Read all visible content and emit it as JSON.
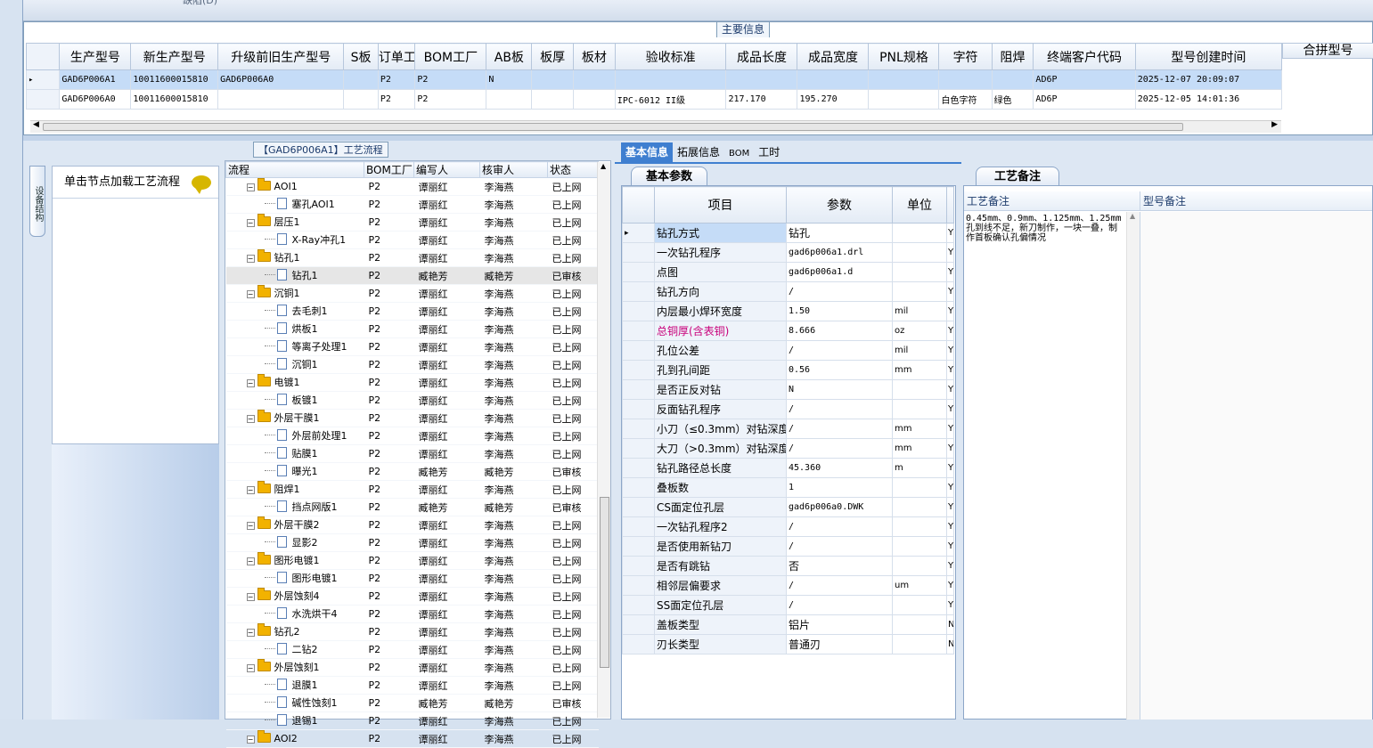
{
  "top": {
    "partial_text": "缺陷(D)"
  },
  "main": {
    "title": "主要信息",
    "columns": [
      "生产型号",
      "新生产型号",
      "升级前旧生产型号",
      "S板",
      "订单工厂",
      "BOM工厂",
      "AB板",
      "板厚",
      "板材",
      "验收标准",
      "成品长度",
      "成品宽度",
      "PNL规格",
      "字符",
      "阻焊",
      "终端客户代码",
      "型号创建时间"
    ],
    "rows": [
      [
        "GAD6P006A1",
        "10011600015810",
        "GAD6P006A0",
        "",
        "P2",
        "P2",
        "N",
        "",
        "",
        "",
        "",
        "",
        "",
        "",
        "",
        "AD6P",
        "2025-12-07 20:09:07"
      ],
      [
        "GAD6P006A0",
        "10011600015810",
        "",
        "",
        "P2",
        "P2",
        "",
        "",
        "",
        "IPC-6012 II级",
        "217.170",
        "195.270",
        "",
        "白色字符",
        "绿色",
        "AD6P",
        "2025-12-05 14:01:36"
      ]
    ],
    "merge_column": "合拼型号"
  },
  "side": {
    "vertical_tab": "设备结构",
    "hint": "单击节点加载工艺流程"
  },
  "tree": {
    "title": "【GAD6P006A1】工艺流程",
    "columns": [
      "流程",
      "BOM工厂",
      "编写人",
      "核审人",
      "状态"
    ],
    "rows": [
      {
        "name": "AOI1",
        "level": 0,
        "factory": "P2",
        "writer": "谭丽红",
        "reviewer": "李海燕",
        "status": "已上网"
      },
      {
        "name": "塞孔AOI1",
        "level": 1,
        "factory": "P2",
        "writer": "谭丽红",
        "reviewer": "李海燕",
        "status": "已上网"
      },
      {
        "name": "层压1",
        "level": 0,
        "factory": "P2",
        "writer": "谭丽红",
        "reviewer": "李海燕",
        "status": "已上网"
      },
      {
        "name": "X-Ray冲孔1",
        "level": 1,
        "factory": "P2",
        "writer": "谭丽红",
        "reviewer": "李海燕",
        "status": "已上网"
      },
      {
        "name": "钻孔1",
        "level": 0,
        "factory": "P2",
        "writer": "谭丽红",
        "reviewer": "李海燕",
        "status": "已上网"
      },
      {
        "name": "钻孔1",
        "level": 1,
        "factory": "P2",
        "writer": "臧艳芳",
        "reviewer": "臧艳芳",
        "status": "已审核",
        "highlight": true
      },
      {
        "name": "沉铜1",
        "level": 0,
        "factory": "P2",
        "writer": "谭丽红",
        "reviewer": "李海燕",
        "status": "已上网"
      },
      {
        "name": "去毛刺1",
        "level": 1,
        "factory": "P2",
        "writer": "谭丽红",
        "reviewer": "李海燕",
        "status": "已上网"
      },
      {
        "name": "烘板1",
        "level": 1,
        "factory": "P2",
        "writer": "谭丽红",
        "reviewer": "李海燕",
        "status": "已上网"
      },
      {
        "name": "等离子处理1",
        "level": 1,
        "factory": "P2",
        "writer": "谭丽红",
        "reviewer": "李海燕",
        "status": "已上网"
      },
      {
        "name": "沉铜1",
        "level": 1,
        "factory": "P2",
        "writer": "谭丽红",
        "reviewer": "李海燕",
        "status": "已上网"
      },
      {
        "name": "电镀1",
        "level": 0,
        "factory": "P2",
        "writer": "谭丽红",
        "reviewer": "李海燕",
        "status": "已上网"
      },
      {
        "name": "板镀1",
        "level": 1,
        "factory": "P2",
        "writer": "谭丽红",
        "reviewer": "李海燕",
        "status": "已上网"
      },
      {
        "name": "外层干膜1",
        "level": 0,
        "factory": "P2",
        "writer": "谭丽红",
        "reviewer": "李海燕",
        "status": "已上网"
      },
      {
        "name": "外层前处理1",
        "level": 1,
        "factory": "P2",
        "writer": "谭丽红",
        "reviewer": "李海燕",
        "status": "已上网"
      },
      {
        "name": "贴膜1",
        "level": 1,
        "factory": "P2",
        "writer": "谭丽红",
        "reviewer": "李海燕",
        "status": "已上网"
      },
      {
        "name": "曝光1",
        "level": 1,
        "factory": "P2",
        "writer": "臧艳芳",
        "reviewer": "臧艳芳",
        "status": "已审核"
      },
      {
        "name": "阻焊1",
        "level": 0,
        "factory": "P2",
        "writer": "谭丽红",
        "reviewer": "李海燕",
        "status": "已上网"
      },
      {
        "name": "挡点网版1",
        "level": 1,
        "factory": "P2",
        "writer": "臧艳芳",
        "reviewer": "臧艳芳",
        "status": "已审核"
      },
      {
        "name": "外层干膜2",
        "level": 0,
        "factory": "P2",
        "writer": "谭丽红",
        "reviewer": "李海燕",
        "status": "已上网"
      },
      {
        "name": "显影2",
        "level": 1,
        "factory": "P2",
        "writer": "谭丽红",
        "reviewer": "李海燕",
        "status": "已上网"
      },
      {
        "name": "图形电镀1",
        "level": 0,
        "factory": "P2",
        "writer": "谭丽红",
        "reviewer": "李海燕",
        "status": "已上网"
      },
      {
        "name": "图形电镀1",
        "level": 1,
        "factory": "P2",
        "writer": "谭丽红",
        "reviewer": "李海燕",
        "status": "已上网"
      },
      {
        "name": "外层蚀刻4",
        "level": 0,
        "factory": "P2",
        "writer": "谭丽红",
        "reviewer": "李海燕",
        "status": "已上网"
      },
      {
        "name": "水洗烘干4",
        "level": 1,
        "factory": "P2",
        "writer": "谭丽红",
        "reviewer": "李海燕",
        "status": "已上网"
      },
      {
        "name": "钻孔2",
        "level": 0,
        "factory": "P2",
        "writer": "谭丽红",
        "reviewer": "李海燕",
        "status": "已上网"
      },
      {
        "name": "二钻2",
        "level": 1,
        "factory": "P2",
        "writer": "谭丽红",
        "reviewer": "李海燕",
        "status": "已上网"
      },
      {
        "name": "外层蚀刻1",
        "level": 0,
        "factory": "P2",
        "writer": "谭丽红",
        "reviewer": "李海燕",
        "status": "已上网"
      },
      {
        "name": "退膜1",
        "level": 1,
        "factory": "P2",
        "writer": "谭丽红",
        "reviewer": "李海燕",
        "status": "已上网"
      },
      {
        "name": "碱性蚀刻1",
        "level": 1,
        "factory": "P2",
        "writer": "臧艳芳",
        "reviewer": "臧艳芳",
        "status": "已审核"
      },
      {
        "name": "退锡1",
        "level": 1,
        "factory": "P2",
        "writer": "谭丽红",
        "reviewer": "李海燕",
        "status": "已上网"
      },
      {
        "name": "AOI2",
        "level": 0,
        "factory": "P2",
        "writer": "谭丽红",
        "reviewer": "李海燕",
        "status": "已上网"
      }
    ]
  },
  "tabs": [
    "基本信息",
    "拓展信息",
    "BOM",
    "工时"
  ],
  "params": {
    "panel_tab": "基本参数",
    "columns": [
      "项目",
      "参数",
      "单位"
    ],
    "rows": [
      {
        "item": "钻孔方式",
        "value": "钻孔",
        "unit": "",
        "flag": "Y",
        "selected": true
      },
      {
        "item": "一次钻孔程序",
        "value": "gad6p006a1.drl",
        "unit": "",
        "flag": "Y"
      },
      {
        "item": "点图",
        "value": "gad6p006a1.d",
        "unit": "",
        "flag": "Y"
      },
      {
        "item": "钻孔方向",
        "value": "/",
        "unit": "",
        "flag": "Y"
      },
      {
        "item": "内层最小焊环宽度",
        "value": "1.50",
        "unit": "mil",
        "flag": "Y"
      },
      {
        "item": "总铜厚(含表铜)",
        "value": "8.666",
        "unit": "oz",
        "flag": "Y",
        "red": true
      },
      {
        "item": "孔位公差",
        "value": "/",
        "unit": "mil",
        "flag": "Y"
      },
      {
        "item": "孔到孔间距",
        "value": "0.56",
        "unit": "mm",
        "flag": "Y"
      },
      {
        "item": "是否正反对钻",
        "value": "N",
        "unit": "",
        "flag": "Y"
      },
      {
        "item": "反面钻孔程序",
        "value": "/",
        "unit": "",
        "flag": "Y"
      },
      {
        "item": "小刀（≤0.3mm）对钻深度",
        "value": "/",
        "unit": "mm",
        "flag": "Y"
      },
      {
        "item": "大刀（>0.3mm）对钻深度",
        "value": "/",
        "unit": "mm",
        "flag": "Y"
      },
      {
        "item": "钻孔路径总长度",
        "value": "45.360",
        "unit": "m",
        "flag": "Y"
      },
      {
        "item": "叠板数",
        "value": "1",
        "unit": "",
        "flag": "Y"
      },
      {
        "item": "CS面定位孔层",
        "value": "gad6p006a0.DWK",
        "unit": "",
        "flag": "Y"
      },
      {
        "item": "一次钻孔程序2",
        "value": "/",
        "unit": "",
        "flag": "Y"
      },
      {
        "item": "是否使用新钻刀",
        "value": "/",
        "unit": "",
        "flag": "Y"
      },
      {
        "item": "是否有跳钻",
        "value": "否",
        "unit": "",
        "flag": "Y"
      },
      {
        "item": "相邻层偏要求",
        "value": "/",
        "unit": "um",
        "flag": "Y"
      },
      {
        "item": "SS面定位孔层",
        "value": "/",
        "unit": "",
        "flag": "Y"
      },
      {
        "item": "盖板类型",
        "value": "铝片",
        "unit": "",
        "flag": "N"
      },
      {
        "item": "刃长类型",
        "value": "普通刃",
        "unit": "",
        "flag": "N"
      }
    ]
  },
  "notes": {
    "panel_tab": "工艺备注",
    "col1": "工艺备注",
    "col2": "型号备注",
    "process_note": "0.45mm、0.9mm、1.125mm、1.25mm孔到线不足，新刀制作，一块一叠，制作首板确认孔偏情况",
    "model_note": ""
  },
  "colors": {
    "accent": "#3f7fd0",
    "selection": "#c5dcf7",
    "header": "#e3ebf5",
    "folder": "#f2b200",
    "highlight_text": "#c8007a"
  }
}
